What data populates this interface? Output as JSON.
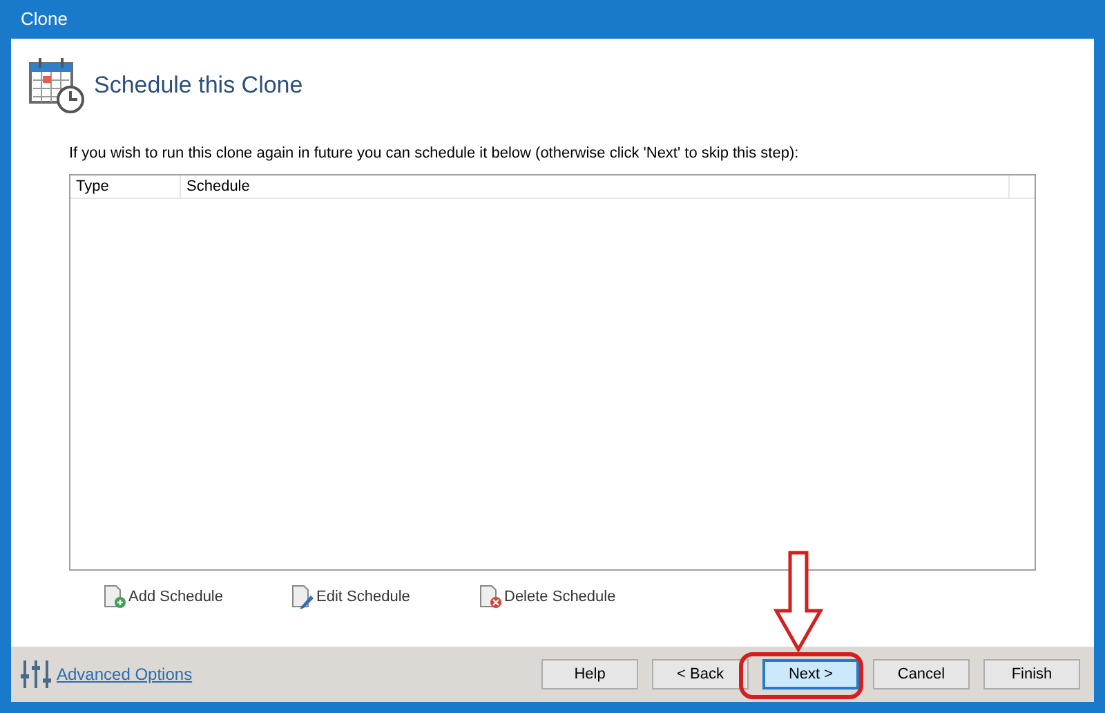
{
  "window": {
    "title": "Clone"
  },
  "header": {
    "title": "Schedule this Clone"
  },
  "instruction": "If you wish to run this clone again in future you can schedule it below (otherwise click 'Next' to skip this step):",
  "table": {
    "columns": [
      "Type",
      "Schedule"
    ]
  },
  "actions": [
    {
      "label": "Add Schedule",
      "kind": "add"
    },
    {
      "label": "Edit Schedule",
      "kind": "edit"
    },
    {
      "label": "Delete Schedule",
      "kind": "delete"
    }
  ],
  "footer": {
    "link": "Advanced Options",
    "buttons": [
      {
        "label": "Help",
        "selected": false
      },
      {
        "label": "< Back",
        "selected": false
      },
      {
        "label": "Next >",
        "selected": true
      },
      {
        "label": "Cancel",
        "selected": false
      },
      {
        "label": "Finish",
        "selected": false
      }
    ]
  }
}
